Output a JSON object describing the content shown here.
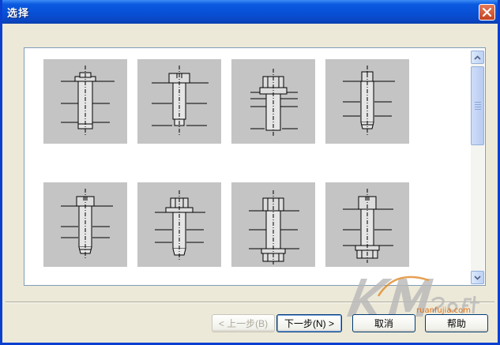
{
  "window": {
    "title": "选择"
  },
  "gallery": {
    "tiles": [
      {
        "name": "fastener-option-1",
        "desc": "flange-head-screw"
      },
      {
        "name": "fastener-option-2",
        "desc": "screw-with-washer"
      },
      {
        "name": "fastener-option-3",
        "desc": "bolt-with-nut"
      },
      {
        "name": "fastener-option-4",
        "desc": "screw-washer-tapped"
      },
      {
        "name": "fastener-option-5",
        "desc": "slotted-screw-tapped"
      },
      {
        "name": "fastener-option-6",
        "desc": "hex-screw-washer"
      },
      {
        "name": "fastener-option-7",
        "desc": "bolt-two-nuts"
      },
      {
        "name": "fastener-option-8",
        "desc": "bolt-washer-nut"
      }
    ]
  },
  "buttons": {
    "prev": "< 上一步(B)",
    "next": "下一步(N) >",
    "cancel": "取消",
    "help": "帮助"
  },
  "watermark": {
    "text": "ruanfujia.com"
  },
  "colors": {
    "titlebar": "#0a5ae0",
    "tile_bg": "#c4c4c4",
    "frame": "#0a3fd0"
  }
}
